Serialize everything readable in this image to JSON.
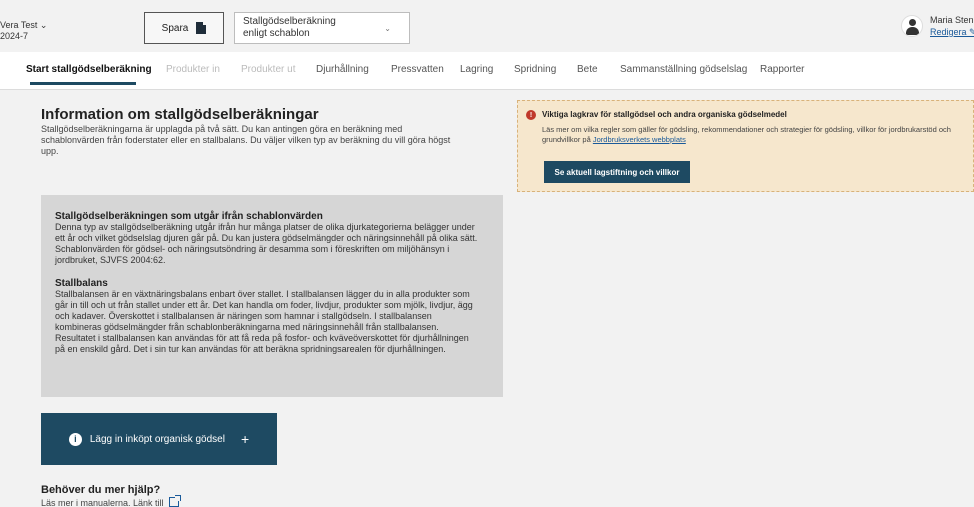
{
  "header": {
    "farm_line1": "Vera Test ⌄",
    "farm_line2": "2024-7",
    "save_label": "Spara",
    "select_value_line1": "Stallgödselberäkning",
    "select_value_line2": "enligt schablon",
    "select_chevron": "⌄",
    "user_name": "Maria Stenb",
    "edit_label": "Redigera ✎"
  },
  "tabs": [
    {
      "label": "Start stallgödselberäkning",
      "state": "active"
    },
    {
      "label": "Produkter in",
      "state": "disabled"
    },
    {
      "label": "Produkter ut",
      "state": "disabled"
    },
    {
      "label": "Djurhållning",
      "state": "normal"
    },
    {
      "label": "Pressvatten",
      "state": "normal"
    },
    {
      "label": "Lagring",
      "state": "normal"
    },
    {
      "label": "Spridning",
      "state": "normal"
    },
    {
      "label": "Bete",
      "state": "normal"
    },
    {
      "label": "Sammanställning gödselslag",
      "state": "normal"
    },
    {
      "label": "Rapporter",
      "state": "normal"
    }
  ],
  "info": {
    "title": "Information om stallgödselberäkningar",
    "text": "Stallgödselberäkningarna är upplagda på två sätt. Du kan antingen göra en beräkning med schablonvärden från foderstater eller en stallbalans. Du väljer vilken typ av beräkning du vill göra högst upp."
  },
  "grey_box": {
    "title1": "Stallgödselberäkningen som utgår ifrån schablonvärden",
    "text1": "Denna typ av stallgödselberäkning utgår ifrån hur många platser de olika djurkategorierna belägger under ett år och vilket gödselslag djuren går på. Du kan justera gödselmängder och näringsinnehåll på olika sätt. Schablonvärden för gödsel- och näringsutsöndring är desamma som i föreskriften om miljöhänsyn i jordbruket, SJVFS 2004:62.",
    "title2": "Stallbalans",
    "text2": "Stallbalansen är en växtnäringsbalans enbart över stallet. I stallbalansen lägger du in alla produkter som går in till och ut från stallet under ett år. Det kan handla om foder, livdjur, produkter som mjölk, livdjur, ägg och kadaver. Överskottet i stallbalansen är näringen som hamnar i stallgödseln. I stallbalansen kombineras gödselmängder från schablonberäkningarna med näringsinnehåll från stallbalansen. Resultatet i stallbalansen kan användas för att få reda på fosfor- och kväveöverskottet för djurhållningen på en enskild gård. Det i sin tur kan användas för att beräkna spridningsarealen för djurhållningen."
  },
  "add_button": {
    "label": "Lägg in inköpt organisk gödsel",
    "info_glyph": "i",
    "plus_glyph": "+"
  },
  "help": {
    "title": "Behöver du mer hjälp?",
    "text": "Läs mer i manualerna. Länk till"
  },
  "warning": {
    "icon_glyph": "!",
    "title": "Viktiga lagkrav för stallgödsel och andra organiska gödselmedel",
    "text": "Läs mer om vilka regler som gäller för gödsling, rekommendationer och strategier för gödsling, villkor för jordbrukarstöd och grundvillkor på ",
    "link": "Jordbruksverkets webbplats",
    "button_label": "Se aktuell lagstiftning och villkor"
  },
  "colors": {
    "accent": "#1e4a62",
    "warning_bg": "#f6e7cd",
    "error": "#c0392b"
  }
}
